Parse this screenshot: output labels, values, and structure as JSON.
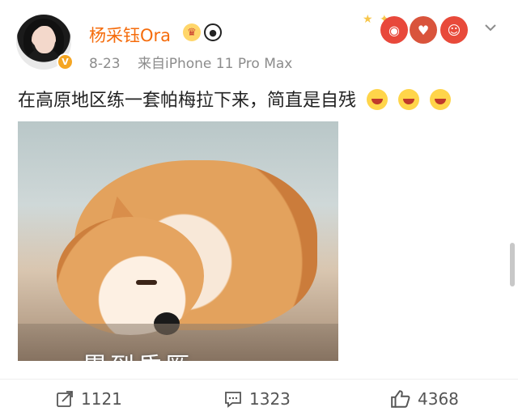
{
  "post": {
    "author": {
      "name": "杨采钰Ora",
      "verified": true,
      "badge_icons": [
        "crown-badge-icon",
        "panda-badge-icon"
      ]
    },
    "time": "8-23",
    "source": "来自iPhone 11 Pro Max",
    "text": "在高原地区练一套帕梅拉下来，简直是自残",
    "emoji_count": 3,
    "image": {
      "caption": "累到昏厥"
    }
  },
  "actions": {
    "repost_count": "1121",
    "comment_count": "1323",
    "like_count": "4368"
  },
  "colors": {
    "username": "#f56c0c",
    "meta": "#8c8c8c",
    "verified_badge": "#f5a623",
    "text": "#222222"
  }
}
